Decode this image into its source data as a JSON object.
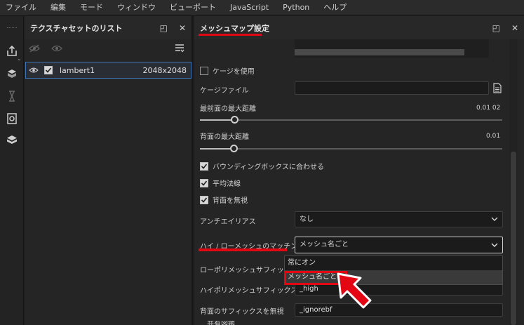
{
  "menu": [
    "ファイル",
    "編集",
    "モード",
    "ウィンドウ",
    "ビューポート",
    "JavaScript",
    "Python",
    "ヘルプ"
  ],
  "texture_panel": {
    "title": "テクスチャセットのリスト",
    "item": {
      "name": "lambert1",
      "resolution": "2048x2048"
    }
  },
  "mesh_panel": {
    "title": "メッシュマップ設定",
    "cage_label": "ケージを使用",
    "cage_file_label": "ケージファイル",
    "front_dist_label": "最前面の最大距離",
    "front_dist_value": "0.01 02",
    "back_dist_label": "背面の最大距離",
    "back_dist_value": "0.01",
    "bbox_label": "バウンディングボックスに合わせる",
    "avg_normals_label": "平均法線",
    "ignore_back_label": "背面を無視",
    "antialias_label": "アンチエイリアス",
    "antialias_value": "なし",
    "matching_label": "ハイ / ローメッシュのマッチング",
    "matching_value": "メッシュ名ごと",
    "matching_options": [
      "常にオン",
      "メッシュ名ごと"
    ],
    "low_suffix_label": "ローポリメッシュサフィックス",
    "high_suffix_label": "ハイポリメッシュサフィックス",
    "high_suffix_value": "_high",
    "ignore_suffix_label": "背面のサフィックスを無視",
    "ignore_suffix_value": "_ignorebf",
    "bottom_cut_label": "共有図鑑"
  },
  "colors": {
    "accent_red": "#e30613",
    "selection_border": "#3c74b8"
  }
}
